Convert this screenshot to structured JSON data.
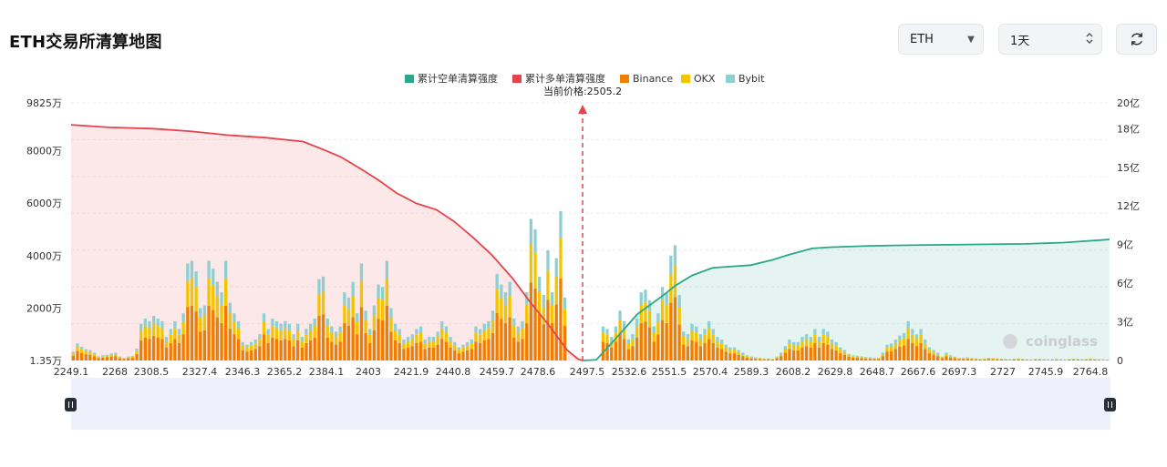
{
  "header": {
    "title": "ETH交易所清算地图",
    "coin_select": "ETH",
    "period_select": "1天"
  },
  "icons": {
    "coin_arrow": "caret-down-icon",
    "period_arrow": "updown-chevron-icon",
    "refresh": "refresh-icon"
  },
  "colors": {
    "short_cumulative": "#2aa88a",
    "long_cumulative": "#e5434a",
    "binance": "#f07d00",
    "okx": "#f5c400",
    "bybit": "#8dcfd3",
    "current_price_marker": "#e5434a",
    "slider_bg": "#eef1fb"
  },
  "chart_data": {
    "type": "bar",
    "legend": {
      "placement": "top-center",
      "items": [
        "累计空单清算强度",
        "累计多单清算强度",
        "Binance",
        "OKX",
        "Bybit"
      ]
    },
    "current_price_label": "当前价格:2505.2",
    "current_price": 2505.2,
    "y_left": {
      "tick_labels": [
        "1.35万",
        "2000万",
        "4000万",
        "6000万",
        "8000万",
        "9825万"
      ],
      "range_wan": [
        1.35,
        9825
      ]
    },
    "y_right": {
      "tick_labels": [
        "0",
        "3亿",
        "6亿",
        "9亿",
        "12亿",
        "15亿",
        "18亿",
        "20亿"
      ],
      "range_yi": [
        0,
        20
      ]
    },
    "x_tick_labels": [
      "2249.1",
      "2268",
      "2308.5",
      "2327.4",
      "2346.3",
      "2365.2",
      "2384.1",
      "2403",
      "2421.9",
      "2440.8",
      "2459.7",
      "2478.6",
      "2497.5",
      "2532.6",
      "2551.5",
      "2570.4",
      "2589.3",
      "2608.2",
      "2629.8",
      "2648.7",
      "2667.6",
      "2697.3",
      "2727",
      "2745.9",
      "2764.8"
    ],
    "x_range": [
      2249.1,
      2769
    ],
    "bars_total_wan": [
      330,
      650,
      520,
      430,
      400,
      300,
      160,
      200,
      220,
      270,
      300,
      150,
      100,
      150,
      180,
      450,
      1400,
      1600,
      1500,
      1700,
      1600,
      1500,
      900,
      1200,
      1500,
      1200,
      1800,
      3700,
      3800,
      3400,
      2000,
      2100,
      3800,
      3500,
      3000,
      2600,
      3800,
      2200,
      1800,
      1500,
      700,
      600,
      700,
      800,
      1000,
      1800,
      1200,
      1600,
      1500,
      1400,
      1500,
      1400,
      1000,
      1400,
      900,
      1200,
      1400,
      1600,
      3100,
      3200,
      1600,
      1300,
      1100,
      1300,
      2600,
      2400,
      3000,
      1800,
      3700,
      1900,
      1200,
      2100,
      2900,
      2800,
      3800,
      2000,
      1400,
      1200,
      800,
      900,
      1000,
      1200,
      1300,
      800,
      900,
      900,
      1100,
      1500,
      1300,
      900,
      700,
      500,
      600,
      700,
      800,
      1300,
      1200,
      1400,
      1500,
      1900,
      3300,
      2900,
      2600,
      3000,
      1600,
      1300,
      1500,
      2600,
      5400,
      5000,
      3200,
      2500,
      4200,
      2600,
      3900,
      5700,
      2400,
      1000,
      2000,
      2100,
      1500,
      1800,
      2200,
      1100,
      1500,
      1300,
      1200,
      900,
      1300,
      1900,
      1500,
      800,
      1000,
      1600,
      2600,
      2700,
      2300,
      1300,
      1800,
      2800,
      2600,
      4000,
      4400,
      2500,
      1100,
      1000,
      1400,
      1300,
      1000,
      1200,
      1500,
      1200,
      900,
      800,
      600,
      500,
      500,
      400,
      300,
      200,
      150,
      120,
      100,
      80,
      80,
      60,
      150,
      300,
      550,
      800,
      700,
      700,
      900,
      1000,
      900,
      1200,
      900,
      1200,
      1100,
      800,
      700,
      500,
      400,
      250,
      200,
      180,
      160,
      140,
      120,
      100,
      100,
      300,
      600,
      650,
      800,
      950,
      1050,
      1500,
      1200,
      1000,
      1200,
      800,
      500,
      400,
      300,
      150,
      300,
      200,
      150,
      100,
      100,
      120,
      90,
      80,
      60,
      80,
      100,
      90,
      80,
      70,
      60,
      50,
      70,
      80,
      60,
      50,
      40,
      60,
      60,
      50,
      40,
      50,
      60,
      50,
      40,
      60,
      70,
      60,
      50,
      60,
      80,
      60,
      50,
      40,
      30
    ],
    "cumulative_long_yi": [
      [
        2249.1,
        18.3
      ],
      [
        2268,
        18.1
      ],
      [
        2290,
        18.0
      ],
      [
        2308.5,
        17.8
      ],
      [
        2327.4,
        17.5
      ],
      [
        2346.3,
        17.3
      ],
      [
        2365.2,
        17.0
      ],
      [
        2375,
        16.4
      ],
      [
        2384.1,
        15.8
      ],
      [
        2395,
        14.8
      ],
      [
        2403,
        14.0
      ],
      [
        2412,
        13.0
      ],
      [
        2421.9,
        12.2
      ],
      [
        2432,
        11.7
      ],
      [
        2440.8,
        10.8
      ],
      [
        2450,
        9.6
      ],
      [
        2459.7,
        8.2
      ],
      [
        2470,
        6.4
      ],
      [
        2478.6,
        4.6
      ],
      [
        2488,
        2.8
      ],
      [
        2497.5,
        0.8
      ],
      [
        2503,
        0.1
      ],
      [
        2505.2,
        0
      ]
    ],
    "cumulative_short_yi": [
      [
        2505.2,
        0
      ],
      [
        2512,
        0.05
      ],
      [
        2520,
        1.4
      ],
      [
        2532.6,
        3.6
      ],
      [
        2545,
        5.0
      ],
      [
        2551.5,
        5.8
      ],
      [
        2560,
        6.6
      ],
      [
        2570.4,
        7.2
      ],
      [
        2589.3,
        7.4
      ],
      [
        2600,
        7.8
      ],
      [
        2608.2,
        8.2
      ],
      [
        2620,
        8.7
      ],
      [
        2629.8,
        8.8
      ],
      [
        2648.7,
        8.9
      ],
      [
        2667.6,
        8.95
      ],
      [
        2697.3,
        9.0
      ],
      [
        2727,
        9.05
      ],
      [
        2745.9,
        9.15
      ],
      [
        2764.8,
        9.35
      ],
      [
        2769,
        9.4
      ]
    ],
    "bar_split": {
      "binance": 0.55,
      "okx": 0.27,
      "bybit": 0.18
    }
  },
  "watermark": "coinglass"
}
